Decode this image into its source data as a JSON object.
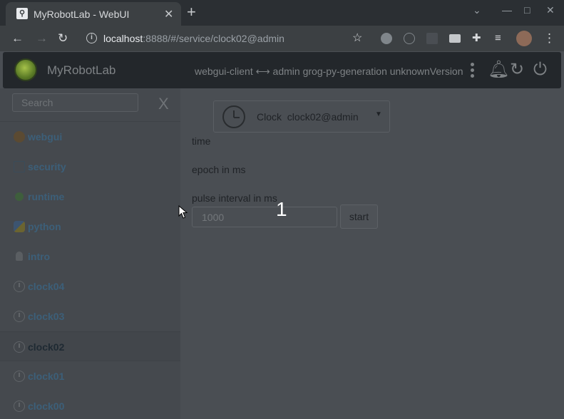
{
  "browser": {
    "tab_title": "MyRobotLab - WebUI",
    "tab_close": "✕",
    "new_tab": "+",
    "url_host": "localhost",
    "url_rest": ":8888/#/service/clock02@admin"
  },
  "header": {
    "brand": "MyRobotLab",
    "status": "webgui-client ⟷ admin grog-py-generation unknownVersion"
  },
  "sidebar": {
    "search_placeholder": "Search",
    "clear_label": "X",
    "items": [
      {
        "label": "webgui",
        "icon": "globe-icon",
        "color": "#5b4a32"
      },
      {
        "label": "security",
        "icon": "lock-icon",
        "color": "#3a4c5a"
      },
      {
        "label": "runtime",
        "icon": "runtime-icon",
        "color": "#3e5e3c"
      },
      {
        "label": "python",
        "icon": "python-icon",
        "color": "#3c5470"
      },
      {
        "label": "intro",
        "icon": "bulb-icon",
        "color": "#5a5e62"
      },
      {
        "label": "clock04",
        "icon": "clock-icon"
      },
      {
        "label": "clock03",
        "icon": "clock-icon"
      },
      {
        "label": "clock02",
        "icon": "clock-icon",
        "active": true
      },
      {
        "label": "clock01",
        "icon": "clock-icon"
      },
      {
        "label": "clock00",
        "icon": "clock-icon"
      }
    ]
  },
  "service": {
    "type": "Clock",
    "name": "clock02@admin",
    "fields": {
      "time_label": "time",
      "epoch_label": "epoch in ms",
      "pulse_label": "pulse interval in ms"
    },
    "pulse_placeholder": "1000",
    "start_label": "start"
  },
  "overlay": {
    "step_number": "1"
  }
}
